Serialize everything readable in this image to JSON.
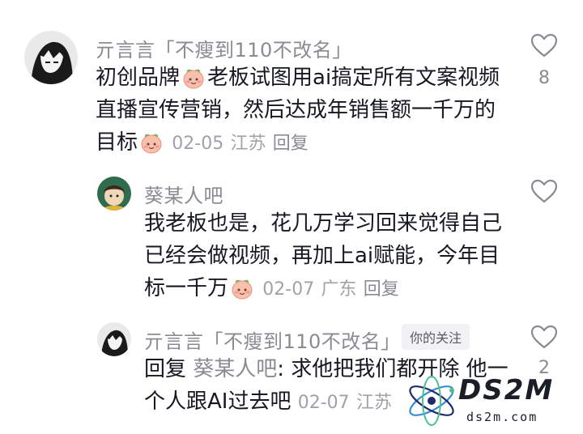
{
  "comments": [
    {
      "username": "亓言言「不瘦到110不改名」",
      "lines": [
        "初创品牌",
        "老板试图用ai搞定所有文案视频",
        "直播宣传营销，然后达成年销售额一千万的",
        "目标"
      ],
      "date": "02-05",
      "location": "江苏",
      "reply_label": "回复",
      "like_count": "8"
    },
    {
      "username": "葵某人吧",
      "lines": [
        "我老板也是，花几万学习回来觉得自己",
        "已经会做视频，再加上ai赋能，今年目",
        "标一千万"
      ],
      "date": "02-07",
      "location": "广东",
      "reply_label": "回复",
      "like_count": ""
    },
    {
      "username": "亓言言「不瘦到110不改名」",
      "badge": "你的关注",
      "reply_prefix": "回复",
      "mention": "葵某人吧",
      "lines": [
        ": 求他把我们都开除 他一",
        "个人跟AI过去吧"
      ],
      "date": "02-07",
      "location": "江苏",
      "like_count": "2"
    }
  ],
  "icons": [
    "heart-outline-icon",
    "peach-emoji-icon"
  ],
  "watermark": {
    "logo": "DS2M",
    "url": "ds2m.com"
  },
  "colors": {
    "text": "#161823",
    "muted": "#8a8b91",
    "meta": "#a1a2a7",
    "peach": "#f7b9a8"
  }
}
